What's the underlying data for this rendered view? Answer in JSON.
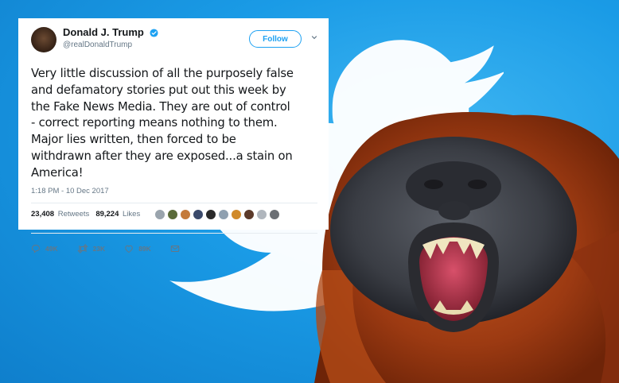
{
  "tweet": {
    "display_name": "Donald J. Trump",
    "handle": "@realDonaldTrump",
    "follow_label": "Follow",
    "text": "Very little discussion of all the purposely false\nand defamatory stories put out this week by\nthe Fake News Media. They are out of control\n- correct reporting means nothing to them.\nMajor lies written, then forced to be\nwithdrawn after they are exposed...a stain on\nAmerica!",
    "timestamp": "1:18 PM - 10 Dec 2017",
    "retweets_count": "23,408",
    "retweets_label": "Retweets",
    "likes_count": "89,224",
    "likes_label": "Likes",
    "reply_count": "49K",
    "retweet_action_count": "23K",
    "like_action_count": "89K",
    "liker_colors": [
      "#9aa4ad",
      "#5a6b3a",
      "#c47a3a",
      "#3b4a6b",
      "#2a2a2a",
      "#8fa0b0",
      "#d08a2a",
      "#5c3a2a",
      "#b0b6bd",
      "#6b6f74"
    ]
  },
  "colors": {
    "brand_blue": "#1da1f2",
    "background_blue": "#1a9be6"
  },
  "icons": [
    "verified-icon",
    "chevron-down-icon",
    "reply-icon",
    "retweet-icon",
    "like-icon",
    "direct-message-icon",
    "twitter-bird-icon"
  ]
}
